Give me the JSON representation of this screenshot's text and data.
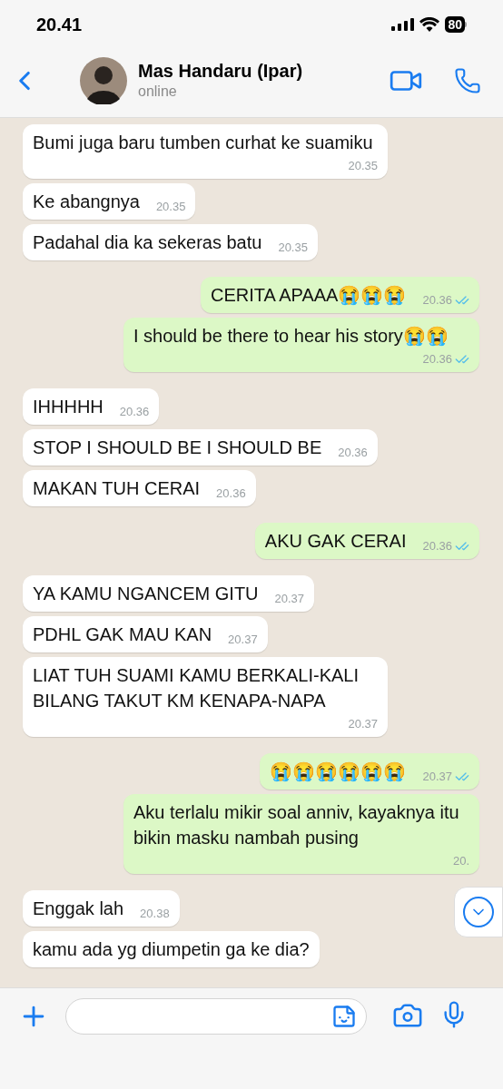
{
  "status_bar": {
    "time": "20.41",
    "battery": "80"
  },
  "header": {
    "name": "Mas Handaru (Ipar)",
    "status": "online"
  },
  "messages": [
    {
      "outgoing": false,
      "text": "Bumi juga baru tumben curhat ke suamiku",
      "time": "20.35"
    },
    {
      "outgoing": false,
      "text": "Ke abangnya",
      "time": "20.35"
    },
    {
      "outgoing": false,
      "text": "Padahal dia ka sekeras batu",
      "time": "20.35"
    },
    {
      "outgoing": true,
      "text": "CERITA APAAA😭😭😭",
      "time": "20.36",
      "read": true
    },
    {
      "outgoing": true,
      "text": "I should be there to hear his story😭😭",
      "time": "20.36",
      "read": true
    },
    {
      "outgoing": false,
      "text": "IHHHHH",
      "time": "20.36"
    },
    {
      "outgoing": false,
      "text": "STOP I SHOULD BE I SHOULD BE",
      "time": "20.36"
    },
    {
      "outgoing": false,
      "text": "MAKAN TUH CERAI",
      "time": "20.36"
    },
    {
      "outgoing": true,
      "text": "AKU GAK CERAI",
      "time": "20.36",
      "read": true
    },
    {
      "outgoing": false,
      "text": "YA KAMU NGANCEM GITU",
      "time": "20.37"
    },
    {
      "outgoing": false,
      "text": "PDHL GAK MAU KAN",
      "time": "20.37"
    },
    {
      "outgoing": false,
      "text": "LIAT TUH SUAMI KAMU BERKALI-KALI BILANG TAKUT KM KENAPA-NAPA",
      "time": "20.37"
    },
    {
      "outgoing": true,
      "text": "😭😭😭😭😭😭",
      "time": "20.37",
      "read": true
    },
    {
      "outgoing": true,
      "text": "Aku terlalu mikir soal anniv, kayaknya itu bikin masku nambah pusing",
      "time": "20."
    },
    {
      "outgoing": false,
      "text": "Enggak lah",
      "time": "20.38"
    },
    {
      "outgoing": false,
      "text": "kamu ada yg diumpetin ga ke dia?"
    }
  ]
}
